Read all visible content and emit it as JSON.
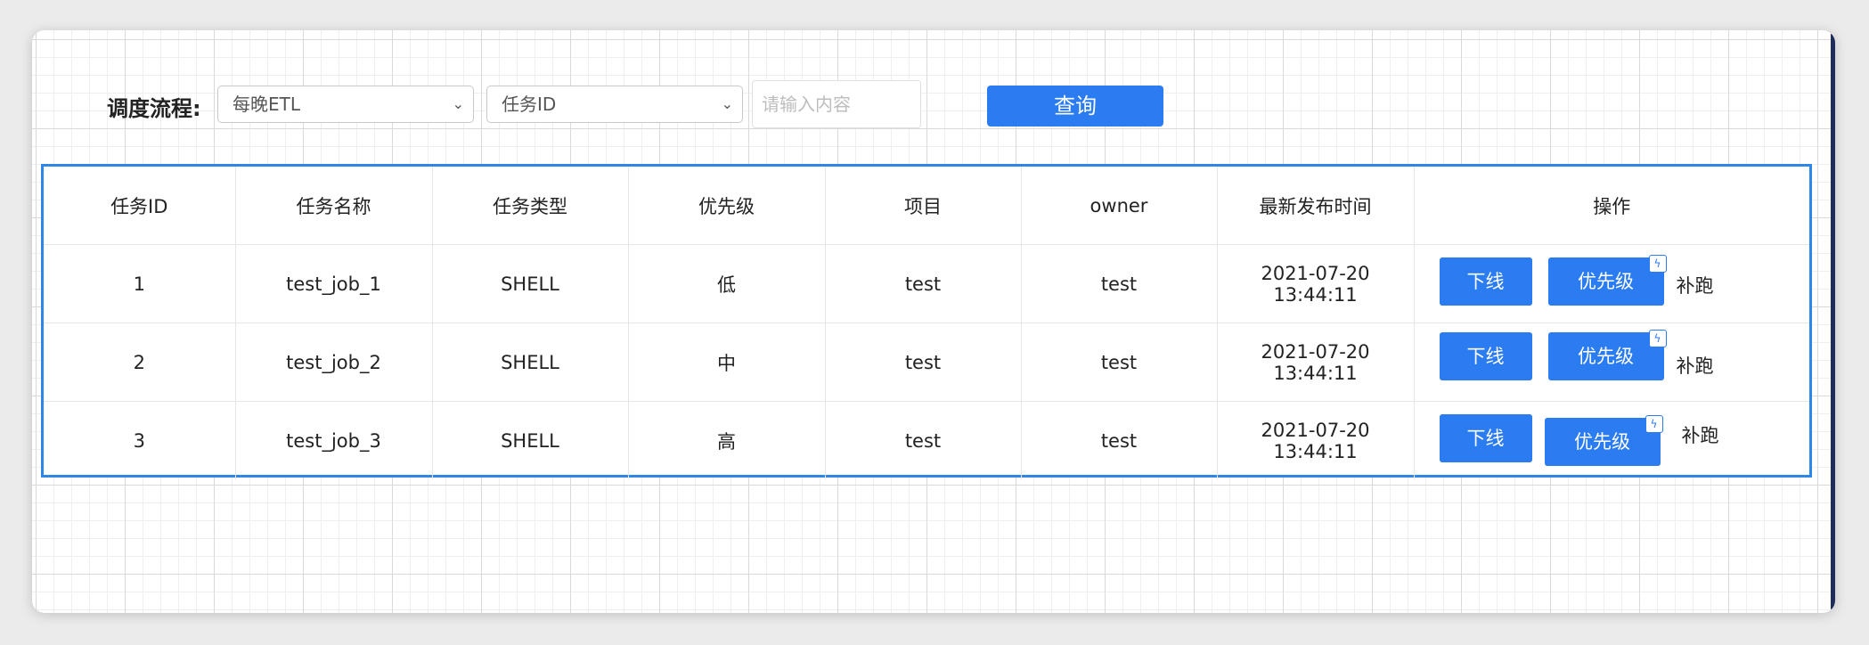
{
  "filter": {
    "label": "调度流程:",
    "process_select": "每晚ETL",
    "field_select": "任务ID",
    "search_placeholder": "请输入内容",
    "query_button": "查询"
  },
  "table": {
    "headers": [
      "任务ID",
      "任务名称",
      "任务类型",
      "优先级",
      "项目",
      "owner",
      "最新发布时间",
      "操作"
    ],
    "rows": [
      {
        "id": "1",
        "name": "test_job_1",
        "type": "SHELL",
        "priority": "低",
        "project": "test",
        "owner": "test",
        "published": "2021-07-20 13:44:11"
      },
      {
        "id": "2",
        "name": "test_job_2",
        "type": "SHELL",
        "priority": "中",
        "project": "test",
        "owner": "test",
        "published": "2021-07-20 13:44:11"
      },
      {
        "id": "3",
        "name": "test_job_3",
        "type": "SHELL",
        "priority": "高",
        "project": "test",
        "owner": "test",
        "published": "2021-07-20 13:44:11"
      }
    ],
    "actions": {
      "offline": "下线",
      "priority": "优先级",
      "rerun": "补跑",
      "badge_icon": "lightning-icon"
    }
  },
  "colors": {
    "accent": "#2b7bf1",
    "table_border": "#2f86e6"
  }
}
